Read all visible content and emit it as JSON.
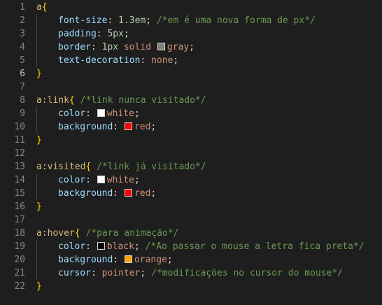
{
  "colors": {
    "background": "#1e1e1e",
    "selector": "#d7ba7d",
    "property": "#9cdcfe",
    "value": "#ce9178",
    "number": "#b5cea8",
    "comment": "#6a9955",
    "brace": "#ffd700",
    "swatch_gray": "#808080",
    "swatch_white": "#ffffff",
    "swatch_red": "#ff0000",
    "swatch_black": "#000000",
    "swatch_orange": "#ffa500"
  },
  "editor": {
    "current_line": 6,
    "lines": [
      {
        "n": "1",
        "t": [
          [
            "sel",
            "a"
          ],
          [
            "brace",
            "{"
          ]
        ]
      },
      {
        "n": "2",
        "i": 1,
        "t": [
          [
            "prop",
            "font-size"
          ],
          [
            "pun",
            ": "
          ],
          [
            "num",
            "1.3em"
          ],
          [
            "pun",
            "; "
          ],
          [
            "cmt",
            "/*em é uma nova forma de px*/"
          ]
        ]
      },
      {
        "n": "3",
        "i": 1,
        "t": [
          [
            "prop",
            "padding"
          ],
          [
            "pun",
            ": "
          ],
          [
            "num",
            "5px"
          ],
          [
            "pun",
            ";"
          ]
        ]
      },
      {
        "n": "4",
        "i": 1,
        "t": [
          [
            "prop",
            "border"
          ],
          [
            "pun",
            ": "
          ],
          [
            "num",
            "1px"
          ],
          [
            "pun",
            " "
          ],
          [
            "val",
            "solid"
          ],
          [
            "pun",
            " "
          ],
          [
            "sw",
            "swatch_gray"
          ],
          [
            "val",
            "gray"
          ],
          [
            "pun",
            ";"
          ]
        ]
      },
      {
        "n": "5",
        "i": 1,
        "t": [
          [
            "prop",
            "text-decoration"
          ],
          [
            "pun",
            ": "
          ],
          [
            "val",
            "none"
          ],
          [
            "pun",
            ";"
          ]
        ]
      },
      {
        "n": "6",
        "t": [
          [
            "brace",
            "}"
          ]
        ]
      },
      {
        "n": "7",
        "t": []
      },
      {
        "n": "8",
        "t": [
          [
            "sel",
            "a:link"
          ],
          [
            "brace",
            "{"
          ],
          [
            "pun",
            " "
          ],
          [
            "cmt",
            "/*link nunca visitado*/"
          ]
        ]
      },
      {
        "n": "9",
        "i": 1,
        "t": [
          [
            "prop",
            "color"
          ],
          [
            "pun",
            ": "
          ],
          [
            "sw",
            "swatch_white"
          ],
          [
            "val",
            "white"
          ],
          [
            "pun",
            ";"
          ]
        ]
      },
      {
        "n": "10",
        "i": 1,
        "t": [
          [
            "prop",
            "background"
          ],
          [
            "pun",
            ": "
          ],
          [
            "sw",
            "swatch_red"
          ],
          [
            "val",
            "red"
          ],
          [
            "pun",
            ";"
          ]
        ]
      },
      {
        "n": "11",
        "t": [
          [
            "brace",
            "}"
          ]
        ]
      },
      {
        "n": "12",
        "t": []
      },
      {
        "n": "13",
        "t": [
          [
            "sel",
            "a:visited"
          ],
          [
            "brace",
            "{"
          ],
          [
            "pun",
            " "
          ],
          [
            "cmt",
            "/*link já visitado*/"
          ]
        ]
      },
      {
        "n": "14",
        "i": 1,
        "t": [
          [
            "prop",
            "color"
          ],
          [
            "pun",
            ": "
          ],
          [
            "sw",
            "swatch_white"
          ],
          [
            "val",
            "white"
          ],
          [
            "pun",
            ";"
          ]
        ]
      },
      {
        "n": "15",
        "i": 1,
        "t": [
          [
            "prop",
            "background"
          ],
          [
            "pun",
            ": "
          ],
          [
            "sw",
            "swatch_red"
          ],
          [
            "val",
            "red"
          ],
          [
            "pun",
            ";"
          ]
        ]
      },
      {
        "n": "16",
        "t": [
          [
            "brace",
            "}"
          ]
        ]
      },
      {
        "n": "17",
        "t": []
      },
      {
        "n": "18",
        "t": [
          [
            "sel",
            "a:hover"
          ],
          [
            "brace",
            "{"
          ],
          [
            "pun",
            " "
          ],
          [
            "cmt",
            "/*para animação*/"
          ]
        ]
      },
      {
        "n": "19",
        "i": 1,
        "t": [
          [
            "prop",
            "color"
          ],
          [
            "pun",
            ": "
          ],
          [
            "sw",
            "swatch_black"
          ],
          [
            "val",
            "black"
          ],
          [
            "pun",
            "; "
          ],
          [
            "cmt",
            "/*Ao passar o mouse a letra fica preta*/"
          ]
        ]
      },
      {
        "n": "20",
        "i": 1,
        "t": [
          [
            "prop",
            "background"
          ],
          [
            "pun",
            ": "
          ],
          [
            "sw",
            "swatch_orange"
          ],
          [
            "val",
            "orange"
          ],
          [
            "pun",
            ";"
          ]
        ]
      },
      {
        "n": "21",
        "i": 1,
        "t": [
          [
            "prop",
            "cursor"
          ],
          [
            "pun",
            ": "
          ],
          [
            "val",
            "pointer"
          ],
          [
            "pun",
            "; "
          ],
          [
            "cmt",
            "/*modificações no cursor do mouse*/"
          ]
        ]
      },
      {
        "n": "22",
        "t": [
          [
            "brace",
            "}"
          ]
        ]
      }
    ]
  }
}
